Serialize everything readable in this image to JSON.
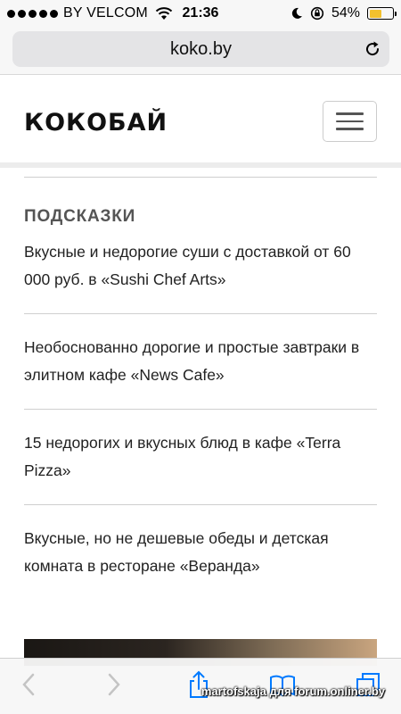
{
  "status_bar": {
    "carrier": "BY VELCOM",
    "time": "21:36",
    "battery_percent": "54%",
    "battery_level": 0.54,
    "battery_color": "#f2c12e"
  },
  "browser": {
    "url": "koko.by"
  },
  "site": {
    "logo": "КОКОБАЙ"
  },
  "section": {
    "title": "ПОДСКАЗКИ",
    "items": [
      "Вкусные и недорогие суши с доставкой от 60 000 руб. в «Sushi Chef Arts»",
      "Необоснованно дорогие и простые завтраки в элитном кафе «News Cafe»",
      "15 недорогих и вкусных блюд в кафе «Terra Pizza»",
      "Вкусные, но не дешевые обеды и детская комната в ресторане «Веранда»"
    ]
  },
  "toolbar": {
    "icons": [
      "back-icon",
      "forward-icon",
      "share-icon",
      "bookmarks-icon",
      "tabs-icon"
    ],
    "accent": "#007aff"
  },
  "watermark": "martofskaja для forum.onliner.by"
}
